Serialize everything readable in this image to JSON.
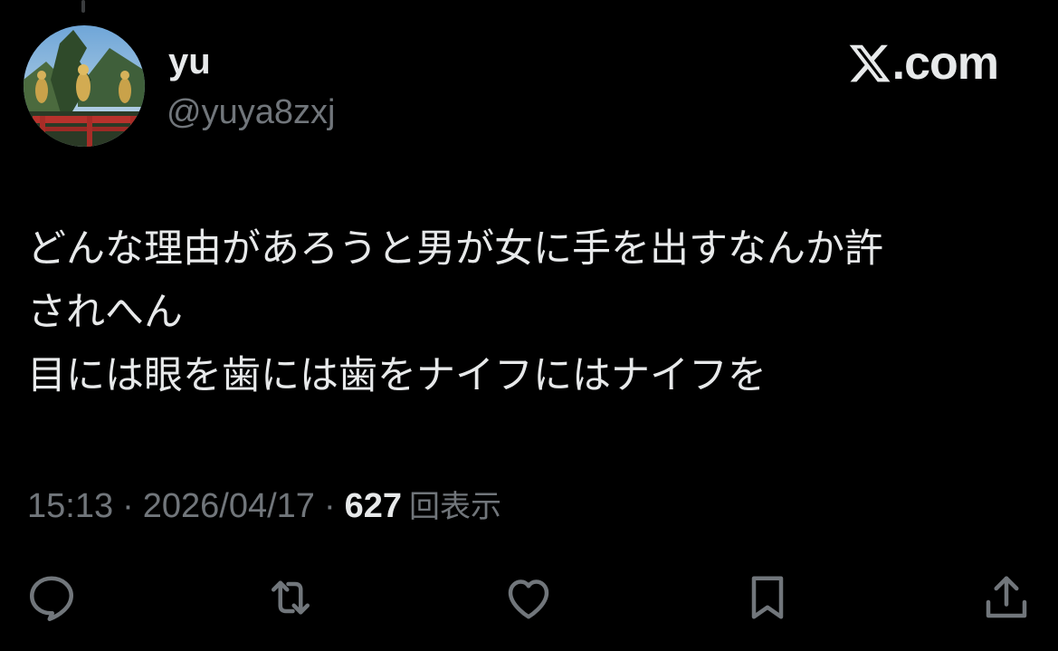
{
  "user": {
    "display_name": "yu",
    "handle": "@yuya8zxj"
  },
  "brand": {
    "label": ".com",
    "icon": "x-logo-icon"
  },
  "tweet": {
    "lines": [
      "どんな理由があろうと男が女に手を出すなんか許",
      "されへん",
      "目には眼を歯には歯をナイフにはナイフを"
    ]
  },
  "meta": {
    "time": "15:13",
    "separator": "·",
    "date": "2026/04/17",
    "views_count": "627",
    "views_label": "回表示"
  },
  "actions": [
    {
      "name": "reply",
      "icon": "reply-icon"
    },
    {
      "name": "retweet",
      "icon": "retweet-icon"
    },
    {
      "name": "like",
      "icon": "heart-icon"
    },
    {
      "name": "bookmark",
      "icon": "bookmark-icon"
    },
    {
      "name": "share",
      "icon": "share-icon"
    }
  ],
  "colors": {
    "background": "#000000",
    "primary_text": "#e7e9ea",
    "secondary_text": "#71767b"
  }
}
